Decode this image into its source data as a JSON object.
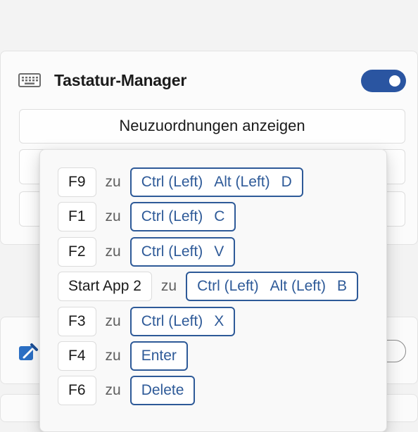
{
  "module": {
    "title": "Tastatur-Manager",
    "icon": "keyboard-icon",
    "enabled": true,
    "accent_color": "#2a55a1",
    "show_button_label": "Neuzuordnungen anzeigen"
  },
  "next_module": {
    "icon": "color-picker-icon",
    "enabled": false
  },
  "remaps": {
    "connector": "zu",
    "items": [
      {
        "from": "F9",
        "to": [
          "Ctrl (Left)",
          "Alt (Left)",
          "D"
        ]
      },
      {
        "from": "F1",
        "to": [
          "Ctrl (Left)",
          "C"
        ]
      },
      {
        "from": "F2",
        "to": [
          "Ctrl (Left)",
          "V"
        ]
      },
      {
        "from": "Start App 2",
        "to": [
          "Ctrl (Left)",
          "Alt (Left)",
          "B"
        ]
      },
      {
        "from": "F3",
        "to": [
          "Ctrl (Left)",
          "X"
        ]
      },
      {
        "from": "F4",
        "to": [
          "Enter"
        ]
      },
      {
        "from": "F6",
        "to": [
          "Delete"
        ]
      }
    ]
  }
}
